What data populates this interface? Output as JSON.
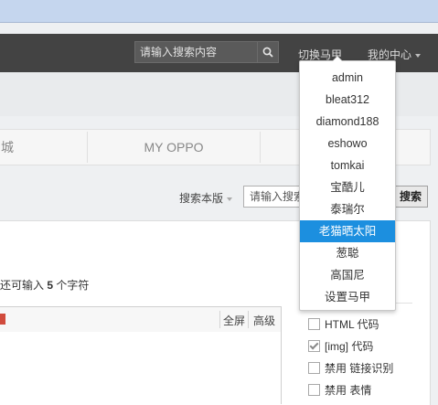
{
  "header": {
    "search_placeholder": "请输入搜索内容",
    "switch_label": "切换马甲",
    "center_label": "我的中心"
  },
  "nav": {
    "items": [
      {
        "label": "城"
      },
      {
        "label": "MY OPPO"
      }
    ]
  },
  "board_search": {
    "label": "搜索本版",
    "input_placeholder": "请输入搜索",
    "button_label": "搜索"
  },
  "post": {
    "remaining_prefix": "还可输入",
    "remaining_count": "5",
    "remaining_suffix": "个字符"
  },
  "editor": {
    "fullscreen_label": "全屏",
    "advanced_label": "高级"
  },
  "options": [
    {
      "label": "HTML 代码",
      "checked": false
    },
    {
      "label": "[img] 代码",
      "checked": true
    },
    {
      "label": "禁用 链接识别",
      "checked": false
    },
    {
      "label": "禁用 表情",
      "checked": false
    }
  ],
  "dropdown": {
    "items": [
      "admin",
      "bleat312",
      "diamond188",
      "eshowo",
      "tomkai",
      "宝酷儿",
      "泰瑞尔",
      "老猫晒太阳",
      "葱聪",
      "高国尼",
      "设置马甲"
    ],
    "active_index": 7,
    "active_color": "#1c8fdf"
  }
}
